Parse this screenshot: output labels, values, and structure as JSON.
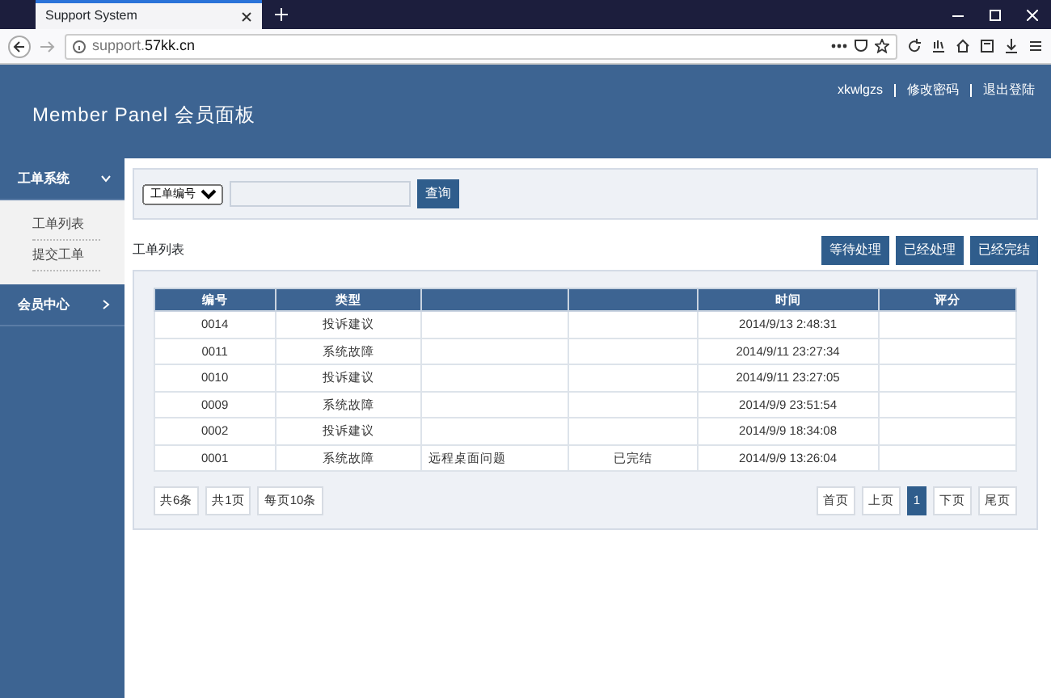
{
  "browser": {
    "tab_title": "Support System",
    "url_host": "support.",
    "url_domain": "57kk.cn"
  },
  "header": {
    "title": "Member Panel 会员面板",
    "user": "xkwlgzs",
    "links": [
      "修改密码",
      "退出登陆"
    ]
  },
  "sidebar": {
    "items": [
      {
        "label": "工单系统",
        "expanded": true,
        "children": [
          {
            "label": "工单列表"
          },
          {
            "label": "提交工单"
          }
        ]
      },
      {
        "label": "会员中心",
        "expanded": false
      }
    ]
  },
  "search": {
    "field_select": "工单编号",
    "button": "查询"
  },
  "list_title": "工单列表",
  "filters": [
    "等待处理",
    "已经处理",
    "已经完结"
  ],
  "table": {
    "columns": [
      {
        "label": "编号"
      },
      {
        "label": "类型"
      },
      {},
      {},
      {
        "label": "时间"
      },
      {
        "label": "评分"
      }
    ],
    "rows": [
      {
        "id": "0014",
        "type": "投诉建议",
        "time": "2014/9/13 2:48:31"
      },
      {
        "id": "0011",
        "type": "系统故障",
        "time": "2014/9/11 23:27:34"
      },
      {
        "id": "0010",
        "type": "投诉建议",
        "time": "2014/9/11 23:27:05"
      },
      {
        "id": "0009",
        "type": "系统故障",
        "time": "2014/9/9 23:51:54"
      },
      {
        "id": "0002",
        "type": "投诉建议",
        "time": "2014/9/9 18:34:08"
      },
      {
        "id": "0001",
        "type": "系统故障",
        "title": "远程桌面问题",
        "status": "已完结",
        "time": "2014/9/9 13:26:04"
      }
    ]
  },
  "pager_info": [
    "共6条",
    "共1页",
    "每页10条"
  ],
  "pager": [
    {
      "label": "首页",
      "selected": false
    },
    {
      "label": "上页",
      "selected": false
    },
    {
      "label": "1",
      "selected": true
    },
    {
      "label": "下页",
      "selected": false
    },
    {
      "label": "尾页",
      "selected": false
    }
  ]
}
